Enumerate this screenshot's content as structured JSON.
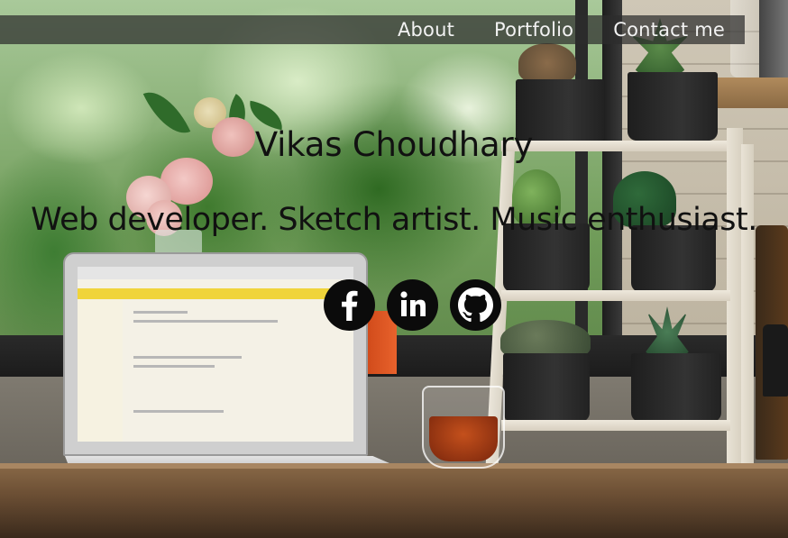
{
  "nav": {
    "items": [
      {
        "label": "About"
      },
      {
        "label": "Portfolio"
      },
      {
        "label": "Contact me"
      }
    ]
  },
  "hero": {
    "name": "Vikas Choudhary",
    "tagline": "Web developer. Sketch artist. Music enthusiast."
  },
  "social": {
    "icons": [
      "facebook-icon",
      "linkedin-icon",
      "github-icon"
    ]
  },
  "colors": {
    "navbar_bg": "#2d2d2d",
    "nav_text": "#f2f2f2",
    "hero_text": "#111111",
    "social_bg": "#0b0b0b"
  }
}
